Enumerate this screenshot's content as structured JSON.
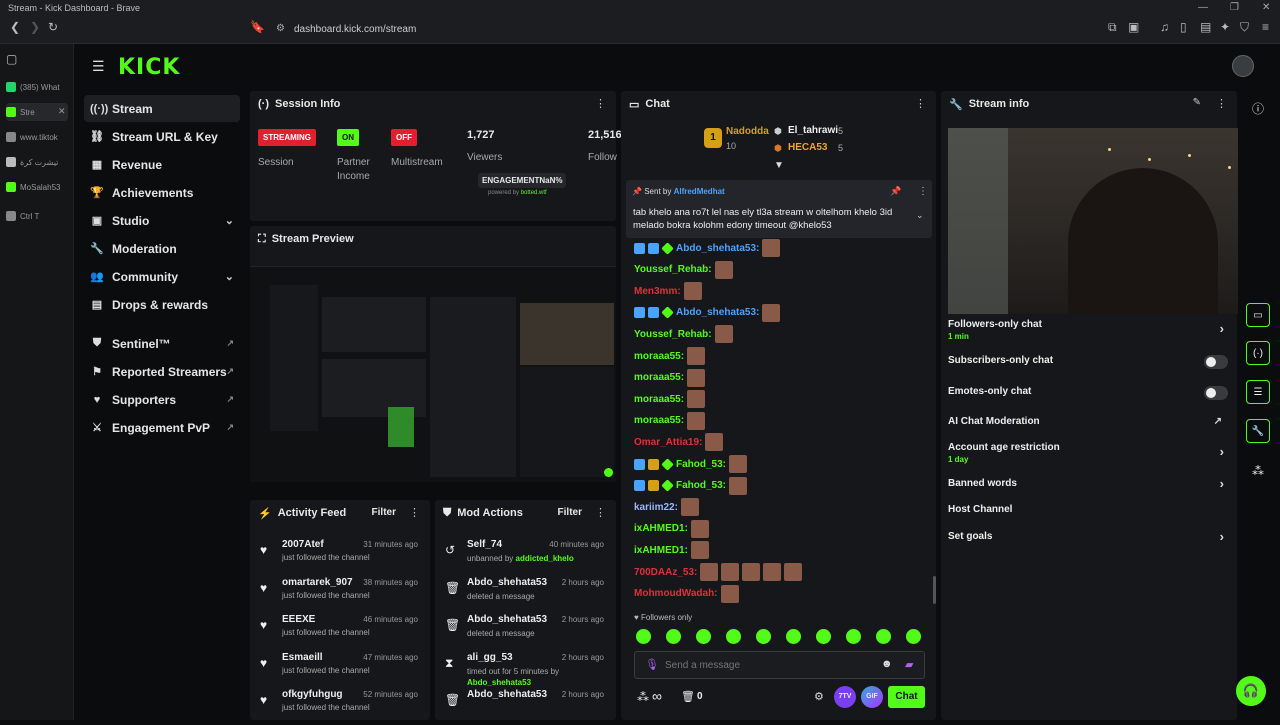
{
  "window": {
    "title": "Stream - Kick Dashboard - Brave"
  },
  "browser": {
    "url": "dashboard.kick.com/stream",
    "sidebar_items": [
      {
        "label": "(385) What",
        "color": "#25d366"
      },
      {
        "label": "Stre",
        "color": "#53fc18"
      },
      {
        "label": "www.tiktok",
        "color": "#888888"
      },
      {
        "label": "تيشرت كرة",
        "color": "#bbbbbb"
      },
      {
        "label": "MoSalah53",
        "color": "#53fc18"
      },
      {
        "label": "Ctrl  T",
        "color": "#888888"
      }
    ]
  },
  "app": {
    "logo": "KICK",
    "accent": "#53fc18",
    "nav": [
      {
        "label": "Stream",
        "icon": "broadcast-icon",
        "glyph": "((·))",
        "active": true
      },
      {
        "label": "Stream URL & Key",
        "icon": "link-icon",
        "glyph": "⛓"
      },
      {
        "label": "Revenue",
        "icon": "revenue-icon",
        "glyph": "▦"
      },
      {
        "label": "Achievements",
        "icon": "trophy-icon",
        "glyph": "🏆"
      },
      {
        "label": "Studio",
        "icon": "studio-icon",
        "glyph": "▣",
        "chevron": true
      },
      {
        "label": "Moderation",
        "icon": "wrench-icon",
        "glyph": "🔧"
      },
      {
        "label": "Community",
        "icon": "community-icon",
        "glyph": "👥",
        "chevron": true
      },
      {
        "label": "Drops & rewards",
        "icon": "drops-icon",
        "glyph": "▤"
      },
      {
        "label": "Sentinel™",
        "icon": "shield-icon",
        "glyph": "⛊",
        "external": true
      },
      {
        "label": "Reported Streamers",
        "icon": "flag-icon",
        "glyph": "⚑",
        "external": true
      },
      {
        "label": "Supporters",
        "icon": "heart-icon",
        "glyph": "♥",
        "external": true
      },
      {
        "label": "Engagement PvP",
        "icon": "swords-icon",
        "glyph": "⚔",
        "external": true
      }
    ]
  },
  "session": {
    "title": "Session Info",
    "status": [
      {
        "badge": "STREAMING",
        "label": "Session",
        "color": "#e0202f"
      },
      {
        "badge": "ON",
        "label": "Partner Income",
        "color": "#53fc18"
      },
      {
        "badge": "OFF",
        "label": "Multistream",
        "color": "#e0202f"
      }
    ],
    "viewers": "1,727",
    "viewers_label": "Viewers",
    "followers": "21,516",
    "followers_label": "Follow",
    "engagement": "ENGAGEMENTNaN%",
    "powered": "powered by",
    "powered_link": "botted.wtf"
  },
  "preview": {
    "title": "Stream Preview"
  },
  "activity": {
    "title": "Activity Feed",
    "filter": "Filter",
    "items": [
      {
        "name": "2007Atef",
        "sub": "just followed the channel",
        "time": "31 minutes ago"
      },
      {
        "name": "omartarek_907",
        "sub": "just followed the channel",
        "time": "38 minutes ago"
      },
      {
        "name": "EEEXE",
        "sub": "just followed the channel",
        "time": "46 minutes ago"
      },
      {
        "name": "Esmaeill",
        "sub": "just followed the channel",
        "time": "47 minutes ago"
      },
      {
        "name": "ofkgyfuhgug",
        "sub": "just followed the channel",
        "time": "52 minutes ago"
      }
    ]
  },
  "mod": {
    "title": "Mod Actions",
    "filter": "Filter",
    "items": [
      {
        "name": "Self_74",
        "sub": "unbanned by",
        "by": "addicted_khelo",
        "time": "40 minutes ago",
        "icon": "unban-icon",
        "glyph": "↺"
      },
      {
        "name": "Abdo_shehata53",
        "sub": "deleted a message",
        "by": "",
        "time": "2 hours ago",
        "icon": "trash-icon",
        "glyph": "🗑"
      },
      {
        "name": "Abdo_shehata53",
        "sub": "deleted a message",
        "by": "",
        "time": "2 hours ago",
        "icon": "trash-icon",
        "glyph": "🗑"
      },
      {
        "name": "ali_gg_53",
        "sub": "timed out for 5 minutes by",
        "by": "Abdo_shehata53",
        "time": "2 hours ago",
        "icon": "hourglass-icon",
        "glyph": "⧗"
      },
      {
        "name": "Abdo_shehata53",
        "sub": "",
        "by": "",
        "time": "2 hours ago",
        "icon": "trash-icon",
        "glyph": "🗑"
      }
    ]
  },
  "chat": {
    "title": "Chat",
    "leaders": [
      {
        "name": "Nadodda",
        "count": "10"
      },
      {
        "name": "El_tahrawi",
        "count": "5"
      },
      {
        "name": "HECA53",
        "count": "5"
      }
    ],
    "pinned": {
      "sent_by": "Sent by",
      "author": "AlfredMedhat",
      "text": "tab khelo ana ro7t lel nas ely tl3a stream w oltelhom khelo 3id melado bokra kolohm edony timeout @khelo53"
    },
    "messages": [
      {
        "name": "Abdo_shehata53:",
        "color": "#4aa3ff",
        "badges": true,
        "emotes": 1
      },
      {
        "name": "Youssef_Rehab:",
        "color": "#53fc18",
        "badges": false,
        "emotes": 1
      },
      {
        "name": "Men3mm:",
        "color": "#e0303a",
        "badges": false,
        "emotes": 1
      },
      {
        "name": "Abdo_shehata53:",
        "color": "#4aa3ff",
        "badges": true,
        "emotes": 1
      },
      {
        "name": "Youssef_Rehab:",
        "color": "#53fc18",
        "badges": false,
        "emotes": 1
      },
      {
        "name": "moraaa55:",
        "color": "#53fc18",
        "badges": false,
        "emotes": 1
      },
      {
        "name": "moraaa55:",
        "color": "#53fc18",
        "badges": false,
        "emotes": 1
      },
      {
        "name": "moraaa55:",
        "color": "#53fc18",
        "badges": false,
        "emotes": 1
      },
      {
        "name": "moraaa55:",
        "color": "#53fc18",
        "badges": false,
        "emotes": 1
      },
      {
        "name": "Omar_Attia19:",
        "color": "#e0303a",
        "badges": false,
        "emotes": 1
      },
      {
        "name": "Fahod_53:",
        "color": "#53fc18",
        "badges": true,
        "emotes": 1
      },
      {
        "name": "Fahod_53:",
        "color": "#53fc18",
        "badges": true,
        "emotes": 1
      },
      {
        "name": "kariim22:",
        "color": "#9ab8ff",
        "badges": false,
        "emotes": 1
      },
      {
        "name": "ixAHMED1:",
        "color": "#53fc18",
        "badges": false,
        "emotes": 1
      },
      {
        "name": "ixAHMED1:",
        "color": "#53fc18",
        "badges": false,
        "emotes": 1
      },
      {
        "name": "700DAAz_53:",
        "color": "#e0303a",
        "badges": false,
        "emotes": 5
      },
      {
        "name": "MohmoudWadah:",
        "color": "#e0303a",
        "badges": false,
        "emotes": 1
      }
    ],
    "followers_only": "Followers only",
    "placeholder": "Send a message",
    "infinity": "∞",
    "count": "0",
    "btn_7tv": "7TV",
    "btn_gif": "GIF",
    "send": "Chat"
  },
  "streaminfo": {
    "title": "Stream info",
    "settings": [
      {
        "label": "Followers-only chat",
        "sub": "1 min",
        "control": "chevron"
      },
      {
        "label": "Subscribers-only chat",
        "sub": "",
        "control": "toggle"
      },
      {
        "label": "Emotes-only chat",
        "sub": "",
        "control": "toggle"
      },
      {
        "label": "AI Chat Moderation",
        "sub": "",
        "control": "external"
      },
      {
        "label": "Account age restriction",
        "sub": "1 day",
        "control": "chevron"
      },
      {
        "label": "Banned words",
        "sub": "",
        "control": "chevron"
      },
      {
        "label": "Host Channel",
        "sub": "",
        "control": "none"
      },
      {
        "label": "Set goals",
        "sub": "",
        "control": "chevron"
      }
    ]
  }
}
